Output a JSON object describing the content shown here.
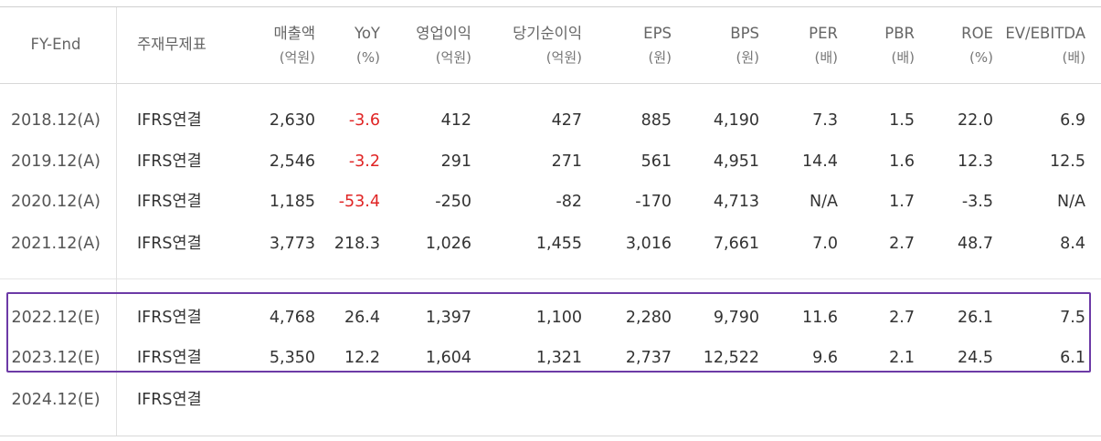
{
  "headers": [
    {
      "label": "FY-End",
      "unit": ""
    },
    {
      "label": "주재무제표",
      "unit": ""
    },
    {
      "label": "매출액",
      "unit": "(억원)"
    },
    {
      "label": "YoY",
      "unit": "(%)"
    },
    {
      "label": "영업이익",
      "unit": "(억원)"
    },
    {
      "label": "당기순이익",
      "unit": "(억원)"
    },
    {
      "label": "EPS",
      "unit": "(원)"
    },
    {
      "label": "BPS",
      "unit": "(원)"
    },
    {
      "label": "PER",
      "unit": "(배)"
    },
    {
      "label": "PBR",
      "unit": "(배)"
    },
    {
      "label": "ROE",
      "unit": "(%)"
    },
    {
      "label": "EV/EBITDA",
      "unit": "(배)"
    }
  ],
  "rows": [
    [
      "2018.12(A)",
      "IFRS연결",
      "2,630",
      "-3.6",
      "412",
      "427",
      "885",
      "4,190",
      "7.3",
      "1.5",
      "22.0",
      "6.9"
    ],
    [
      "2019.12(A)",
      "IFRS연결",
      "2,546",
      "-3.2",
      "291",
      "271",
      "561",
      "4,951",
      "14.4",
      "1.6",
      "12.3",
      "12.5"
    ],
    [
      "2020.12(A)",
      "IFRS연결",
      "1,185",
      "-53.4",
      "-250",
      "-82",
      "-170",
      "4,713",
      "N/A",
      "1.7",
      "-3.5",
      "N/A"
    ],
    [
      "2021.12(A)",
      "IFRS연결",
      "3,773",
      "218.3",
      "1,026",
      "1,455",
      "3,016",
      "7,661",
      "7.0",
      "2.7",
      "48.7",
      "8.4"
    ],
    [
      "2022.12(E)",
      "IFRS연결",
      "4,768",
      "26.4",
      "1,397",
      "1,100",
      "2,280",
      "9,790",
      "11.6",
      "2.7",
      "26.1",
      "7.5"
    ],
    [
      "2023.12(E)",
      "IFRS연결",
      "5,350",
      "12.2",
      "1,604",
      "1,321",
      "2,737",
      "12,522",
      "9.6",
      "2.1",
      "24.5",
      "6.1"
    ],
    [
      "2024.12(E)",
      "IFRS연결",
      "",
      "",
      "",
      "",
      "",
      "",
      "",
      "",
      "",
      ""
    ]
  ],
  "colors": {
    "negative_yoy": "#e02424",
    "highlight_border": "#6c3aa6"
  }
}
